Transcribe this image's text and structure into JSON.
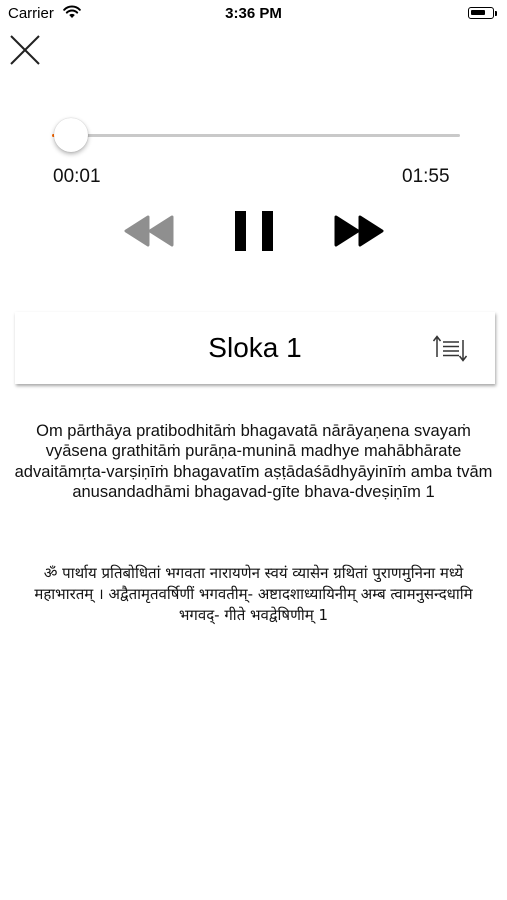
{
  "status": {
    "carrier": "Carrier",
    "time": "3:36 PM"
  },
  "player": {
    "current_time": "00:01",
    "duration": "01:55",
    "progress_fraction": 0.009,
    "accent_color": "#ff6a00"
  },
  "sloka": {
    "title": "Sloka 1",
    "transliteration": "Om pārthāya pratibodhitāṁ bhagavatā nārāyaṇena svayaṁ vyāsena grathitāṁ purāṇa-muninā madhye mahābhārate advaitāmṛta-varṣiṇīṁ bhagavatīm aṣṭādaśādhyāyinīṁ amba tvām anusandadhāmi bhagavad-gīte bhava-dveṣiṇīm 1",
    "sanskrit": "ॐ पार्थाय प्रतिबोधितां भगवता नारायणेन स्वयं व्यासेन ग्रथितां पुराणमुनिना मध्ये महाभारतम् । अद्वैतामृतवर्षिणीं भगवतीम्- अष्टादशाध्यायिनीम् अम्ब त्वामनुसन्दधामि भगवद्- गीते भवद्वेषिणीम् 1"
  },
  "icons": {
    "close": "close-icon",
    "rewind": "rewind-icon",
    "pause": "pause-icon",
    "forward": "fast-forward-icon",
    "sort": "sort-icon"
  }
}
